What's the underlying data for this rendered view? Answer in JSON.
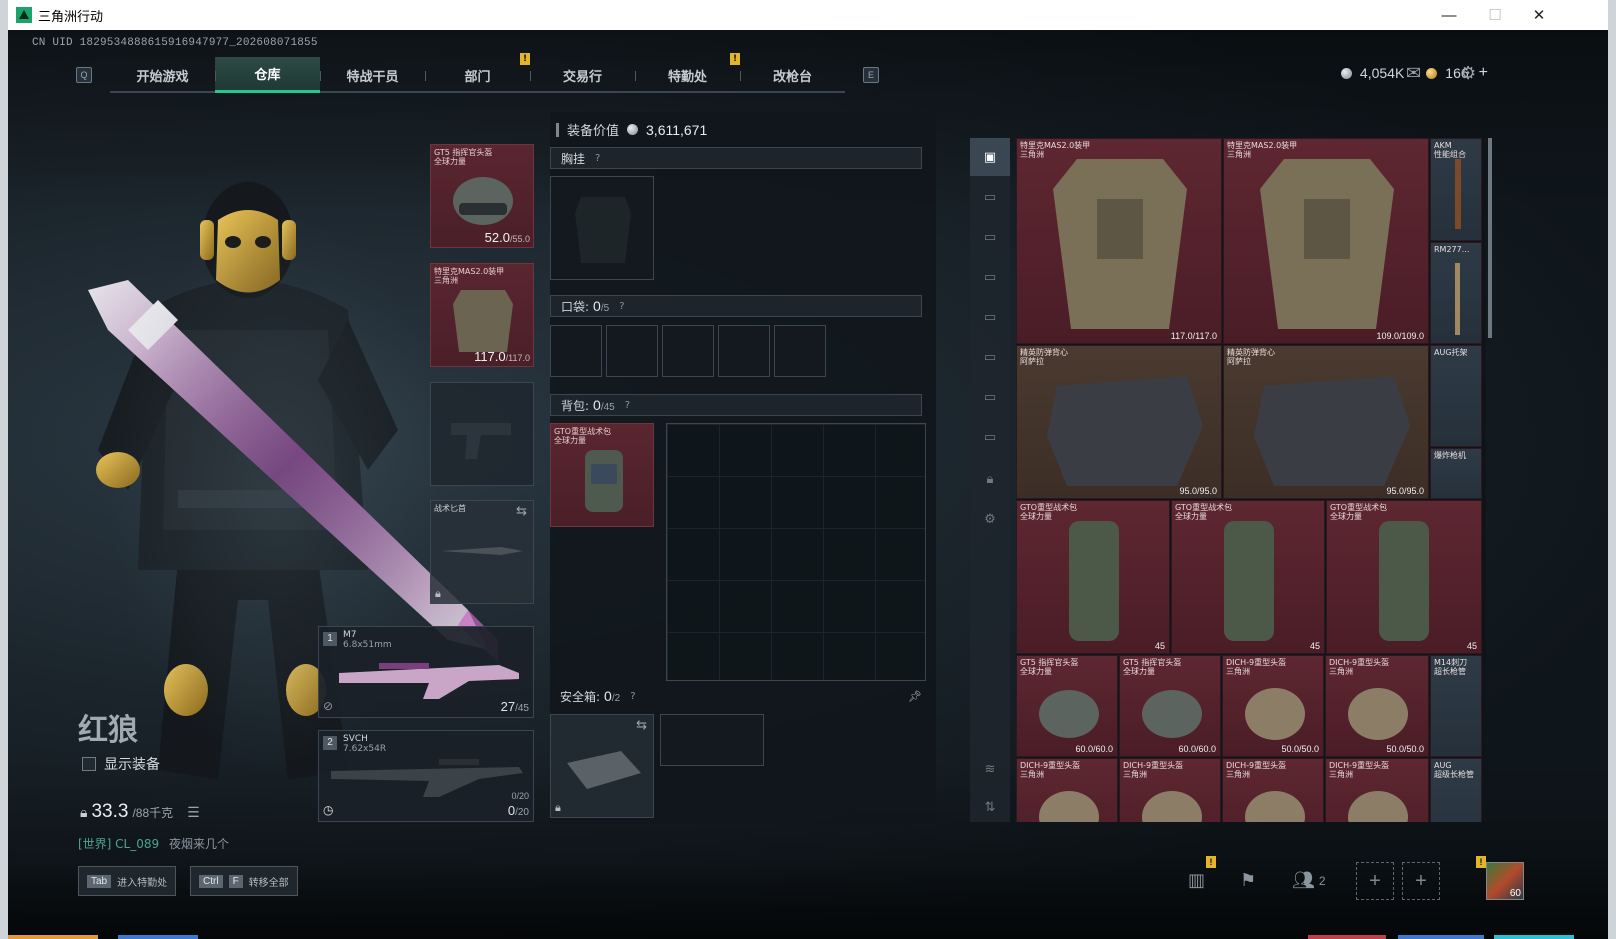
{
  "window": {
    "title": "三角洲行动",
    "minimize": "—",
    "maximize": "☐",
    "close": "✕"
  },
  "uid": "CN UID 1829534888615916947977_202608071855",
  "nav": {
    "left_key": "Q",
    "right_key": "E",
    "tabs": [
      {
        "label": "开始游戏",
        "active": false
      },
      {
        "label": "仓库",
        "active": true
      },
      {
        "label": "特战干员",
        "active": false
      },
      {
        "label": "部门",
        "active": false,
        "alert": "!"
      },
      {
        "label": "交易行",
        "active": false
      },
      {
        "label": "特勤处",
        "active": false,
        "alert": "!"
      },
      {
        "label": "改枪台",
        "active": false
      }
    ]
  },
  "currency": {
    "silver": "4,054K",
    "gold": "166",
    "plus": "+"
  },
  "character": {
    "name": "红狼",
    "show_equipment": "显示装备",
    "weight": "33.3",
    "weight_max": "/88千克",
    "chat_channel": "[世界] CL_089",
    "chat_message": "夜烟来几个"
  },
  "equipment": {
    "helmet": {
      "name": "GT5 指挥官头盔\n全球力量",
      "dur": "52.0",
      "max": "/55.0"
    },
    "armor": {
      "name": "特里克MAS2.0装甲\n三角洲",
      "dur": "117.0",
      "max": "/117.0"
    },
    "melee": {
      "name": "战术匕首"
    },
    "weapon1": {
      "slot": "1",
      "name": "M7",
      "caliber": "6.8x51mm",
      "ammo": "27",
      "ammo_max": "/45"
    },
    "weapon2": {
      "slot": "2",
      "name": "SVCH",
      "caliber": "7.62x54R",
      "ammo_small": "0/20",
      "ammo": "0",
      "ammo_max": "/20"
    }
  },
  "loadout": {
    "value_label": "装备价值",
    "value": "3,611,671",
    "chest_label": "胸挂",
    "pocket_label": "口袋:",
    "pocket_count": "0",
    "pocket_max": "/5",
    "backpack_label": "背包:",
    "backpack_count": "0",
    "backpack_max": "/45",
    "backpack_item": "GTO重型战术包\n全球力量",
    "safe_label": "安全箱:",
    "safe_count": "0",
    "safe_max": "/2",
    "help": "?"
  },
  "warehouse": {
    "label": "仓库",
    "items": [
      {
        "name": "特里克MAS2.0装甲\n三角洲",
        "dur": "117.0/117.0"
      },
      {
        "name": "特里克MAS2.0装甲\n三角洲",
        "dur": "109.0/109.0"
      },
      {
        "name": "AKM\n性能组合"
      },
      {
        "name": "RM277..."
      },
      {
        "name": "精英防弹背心\n阿萨拉",
        "dur": "95.0/95.0"
      },
      {
        "name": "精英防弹背心\n阿萨拉",
        "dur": "95.0/95.0"
      },
      {
        "name": "AUG托架"
      },
      {
        "name": "爆炸枪机"
      },
      {
        "name": "GTO重型战术包\n全球力量",
        "dur": "45"
      },
      {
        "name": "GTO重型战术包\n全球力量",
        "dur": "45"
      },
      {
        "name": "GTO重型战术包\n全球力量",
        "dur": "45"
      },
      {
        "name": "GT5 指挥官头盔\n全球力量",
        "dur": "60.0/60.0"
      },
      {
        "name": "GT5 指挥官头盔\n全球力量",
        "dur": "60.0/60.0"
      },
      {
        "name": "DICH-9重型头盔\n三角洲",
        "dur": "50.0/50.0"
      },
      {
        "name": "DICH-9重型头盔\n三角洲",
        "dur": "50.0/50.0"
      },
      {
        "name": "M14刺刀\n超长枪管"
      },
      {
        "name": "DICH-9重型头盔\n三角洲"
      },
      {
        "name": "DICH-9重型头盔\n三角洲"
      },
      {
        "name": "DICH-9重型头盔\n三角洲"
      },
      {
        "name": "DICH-9重型头盔\n三角洲"
      },
      {
        "name": "AUG\n超级长枪管"
      }
    ]
  },
  "bottom": {
    "tab_key": "Tab",
    "tab_action": "进入特勤处",
    "ctrl_key": "Ctrl",
    "f_key": "F",
    "ctrl_action": "转移全部",
    "squad_count": "2",
    "level": "60",
    "alert": "!"
  }
}
